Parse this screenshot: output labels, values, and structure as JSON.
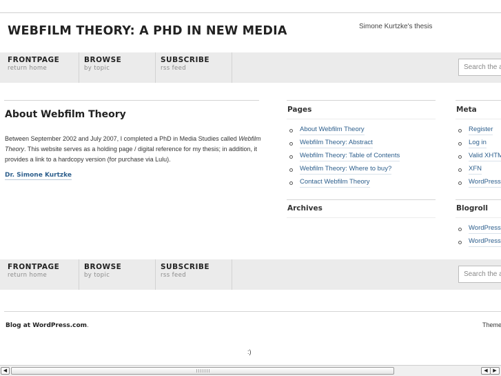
{
  "header": {
    "site_title": "WEBFILM THEORY: A PHD IN NEW MEDIA",
    "tagline": "Simone Kurtzke's thesis"
  },
  "nav_top": {
    "items": [
      {
        "label": "FRONTPAGE",
        "sub": "return home"
      },
      {
        "label": "BROWSE",
        "sub": "by topic"
      },
      {
        "label": "SUBSCRIBE",
        "sub": "rss feed"
      }
    ],
    "search_placeholder": "Search the a"
  },
  "post": {
    "title": "About Webfilm Theory",
    "body_1": "Between September 2002 and July 2007, I completed a PhD in Media Studies called ",
    "body_em": "Webfilm Theory",
    "body_2": ". This website serves as a holding page / digital reference for my thesis; in addition, it provides a link to a hardcopy version (for purchase via Lulu).",
    "signature": "Dr. Simone Kurtzke"
  },
  "pages_widget": {
    "title": "Pages",
    "items": [
      "About Webfilm Theory",
      "Webfilm Theory: Abstract",
      "Webfilm Theory: Table of Contents",
      "Webfilm Theory: Where to buy?",
      "Contact Webfilm Theory"
    ]
  },
  "archives_widget": {
    "title": "Archives"
  },
  "meta_widget": {
    "title": "Meta",
    "items": [
      "Register",
      "Log in",
      "Valid XHTM",
      "XFN",
      "WordPress"
    ]
  },
  "blogroll_widget": {
    "title": "Blogroll",
    "items": [
      "WordPress",
      "WordPress"
    ]
  },
  "nav_bottom": {
    "items": [
      {
        "label": "FRONTPAGE",
        "sub": "return home"
      },
      {
        "label": "BROWSE",
        "sub": "by topic"
      },
      {
        "label": "SUBSCRIBE",
        "sub": "rss feed"
      }
    ],
    "search_placeholder": "Search the a"
  },
  "footer": {
    "blog_link": "Blog at WordPress.com",
    "blog_suffix": ".",
    "theme_text": "Theme",
    "smiley": ":)"
  },
  "scrollbar": {
    "left_glyph": "◀",
    "right_glyph_left": "◀",
    "right_glyph_right": "▶"
  },
  "colors": {
    "link": "#2c5e8c",
    "nav_bg": "#ebebeb",
    "text": "#333333"
  }
}
